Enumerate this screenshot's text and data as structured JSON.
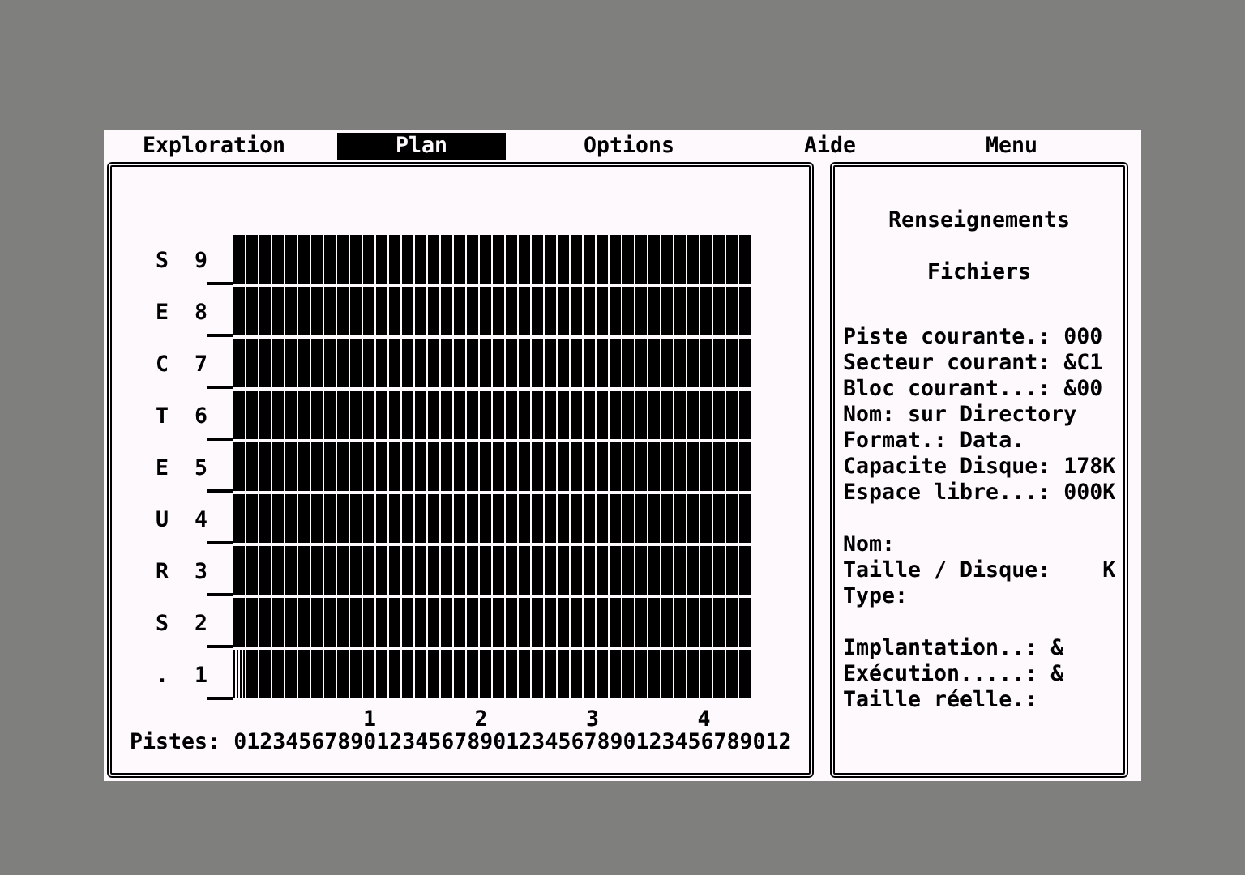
{
  "menu": [
    {
      "label": "Exploration",
      "selected": false
    },
    {
      "label": "Plan",
      "selected": true
    },
    {
      "label": "Options",
      "selected": false
    },
    {
      "label": "Aide",
      "selected": false
    },
    {
      "label": "Menu",
      "selected": false
    }
  ],
  "map": {
    "rows": [
      {
        "letter": "S",
        "sector": "9",
        "selected": false
      },
      {
        "letter": "E",
        "sector": "8",
        "selected": false
      },
      {
        "letter": "C",
        "sector": "7",
        "selected": false
      },
      {
        "letter": "T",
        "sector": "6",
        "selected": false
      },
      {
        "letter": "E",
        "sector": "5",
        "selected": false
      },
      {
        "letter": "U",
        "sector": "4",
        "selected": false
      },
      {
        "letter": "R",
        "sector": "3",
        "selected": false
      },
      {
        "letter": "S",
        "sector": "2",
        "selected": false
      },
      {
        "letter": ".",
        "sector": "1",
        "selected": true
      }
    ],
    "track_tens": [
      "1",
      "2",
      "3",
      "4"
    ],
    "track_label": "Pistes:",
    "track_digits": "0123456789012345678901234567890123456789012"
  },
  "info": {
    "title": "Renseignements",
    "subtitle": "Fichiers",
    "groups": [
      [
        "Piste courante.: 000",
        "Secteur courant: &C1",
        "Bloc courant...: &00",
        "Nom: sur Directory",
        "Format.: Data.",
        "Capacite Disque: 178K",
        "Espace libre...: 000K"
      ],
      [
        "Nom:",
        "Taille / Disque:    K",
        "Type:"
      ],
      [
        "Implantation..: &",
        "Exécution.....: &",
        "Taille réelle.:"
      ]
    ]
  }
}
